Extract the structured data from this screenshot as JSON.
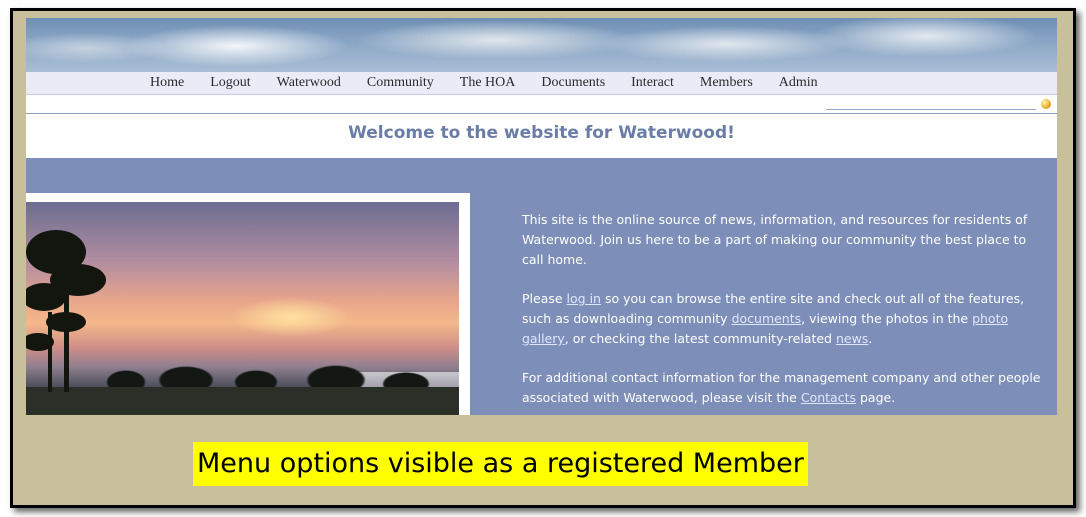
{
  "nav": {
    "items": [
      "Home",
      "Logout",
      "Waterwood",
      "Community",
      "The HOA",
      "Documents",
      "Interact",
      "Members",
      "Admin"
    ]
  },
  "header": {
    "welcome": "Welcome to the website for Waterwood!"
  },
  "icons": {
    "login_status": "status-icon"
  },
  "intro": {
    "p1": "This site is the online source of news, information, and resources for residents of Waterwood.  Join us here to be a part of making our community the best place to call home.",
    "p2_a": "Please ",
    "p2_link_login": "log in",
    "p2_b": " so you can browse the entire site and check out all of the features, such as downloading community ",
    "p2_link_documents": "documents",
    "p2_c": ", viewing the photos in the ",
    "p2_link_photo": "photo gallery",
    "p2_d": ", or checking the latest community-related ",
    "p2_link_news": "news",
    "p2_e": ".",
    "p3_a": "For additional contact information for the management company and other people associated with Waterwood, please visit the ",
    "p3_link_contacts": "Contacts",
    "p3_b": " page."
  },
  "caption": {
    "text": "Menu options visible as a registered Member",
    "highlight_color": "#ffff00"
  },
  "colors": {
    "frame_bg": "#c7c09a",
    "page_bg": "#7d8fb8",
    "welcome_text": "#6b7da6",
    "nav_bg": "#e9ebf7"
  }
}
